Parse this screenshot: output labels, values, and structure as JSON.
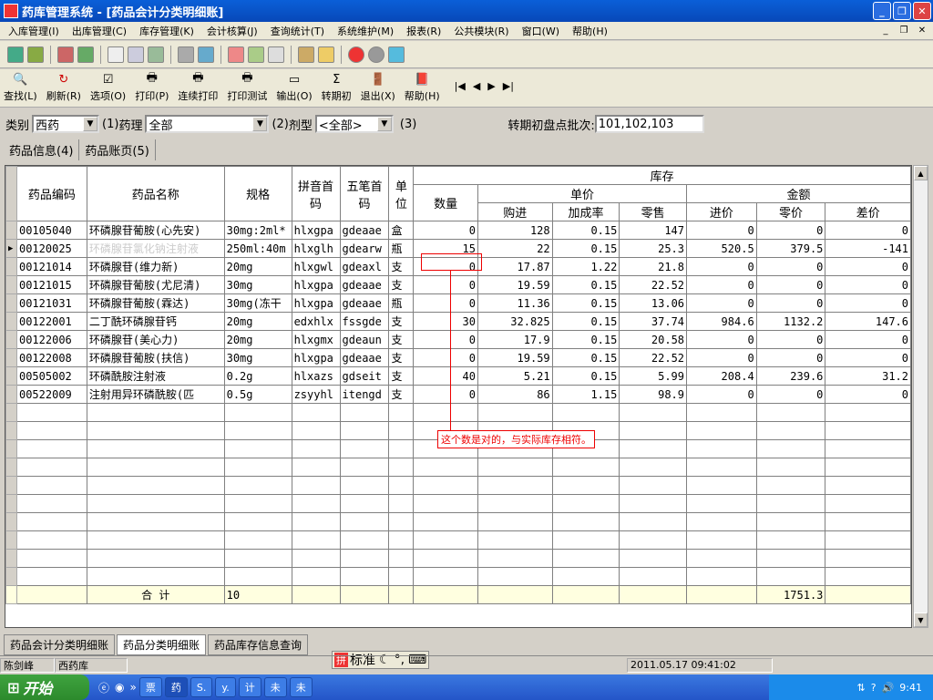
{
  "window": {
    "title": "药库管理系统 - [药品会计分类明细账]"
  },
  "menu": [
    "入库管理(I)",
    "出库管理(C)",
    "库存管理(K)",
    "会计核算(J)",
    "查询统计(T)",
    "系统维护(M)",
    "报表(R)",
    "公共模块(R)",
    "窗口(W)",
    "帮助(H)"
  ],
  "toolbar": {
    "items": [
      "查找(L)",
      "刷新(R)",
      "选项(O)",
      "打印(P)",
      "连续打印",
      "打印测试",
      "输出(O)",
      "转期初",
      "退出(X)",
      "帮助(H)"
    ]
  },
  "filter": {
    "category_label": "类别",
    "category_value": "西药",
    "pharm_prefix": "(1)",
    "pharm_label": "药理",
    "pharm_value": "全部",
    "form_prefix": "(2)",
    "form_label": "剂型",
    "form_value": "<全部>",
    "form_suffix": "(3)",
    "batch_label": "转期初盘点批次:",
    "batch_value": "101,102,103"
  },
  "tabs": [
    "药品信息(4)",
    "药品账页(5)"
  ],
  "table": {
    "headers": {
      "code": "药品编码",
      "name": "药品名称",
      "spec": "规格",
      "pinyin": "拼音首码",
      "wubi": "五笔首码",
      "unit": "单位",
      "stock": "库存",
      "qty": "数量",
      "price": "单价",
      "amount": "金额",
      "buy": "购进",
      "markup": "加成率",
      "retail": "零售",
      "cost": "进价",
      "retail_val": "零价",
      "diff": "差价"
    },
    "rows": [
      {
        "code": "00105040",
        "name": "环磷腺苷葡胺(心先安)",
        "spec": "30mg:2ml*",
        "pinyin": "hlxgpa",
        "wubi": "gdeaae",
        "unit": "盒",
        "qty": "0",
        "buy": "128",
        "markup": "0.15",
        "retail": "147",
        "cost": "0",
        "rv": "0",
        "diff": "0"
      },
      {
        "code": "00120025",
        "name": "环磷腺苷氯化钠注射液",
        "spec": "250ml:40m",
        "pinyin": "hlxglh",
        "wubi": "gdearw",
        "unit": "瓶",
        "qty": "15",
        "buy": "22",
        "markup": "0.15",
        "retail": "25.3",
        "cost": "520.5",
        "rv": "379.5",
        "diff": "-141"
      },
      {
        "code": "00121014",
        "name": "环磷腺苷(维力新)",
        "spec": "20mg",
        "pinyin": "hlxgwl",
        "wubi": "gdeaxl",
        "unit": "支",
        "qty": "0",
        "buy": "17.87",
        "markup": "1.22",
        "retail": "21.8",
        "cost": "0",
        "rv": "0",
        "diff": "0"
      },
      {
        "code": "00121015",
        "name": "环磷腺苷葡胺(尤尼清)",
        "spec": "30mg",
        "pinyin": "hlxgpa",
        "wubi": "gdeaae",
        "unit": "支",
        "qty": "0",
        "buy": "19.59",
        "markup": "0.15",
        "retail": "22.52",
        "cost": "0",
        "rv": "0",
        "diff": "0"
      },
      {
        "code": "00121031",
        "name": "环磷腺苷葡胺(霖达)",
        "spec": "30mg(冻干",
        "pinyin": "hlxgpa",
        "wubi": "gdeaae",
        "unit": "瓶",
        "qty": "0",
        "buy": "11.36",
        "markup": "0.15",
        "retail": "13.06",
        "cost": "0",
        "rv": "0",
        "diff": "0"
      },
      {
        "code": "00122001",
        "name": "二丁酰环磷腺苷钙",
        "spec": "20mg",
        "pinyin": "edxhlx",
        "wubi": "fssgde",
        "unit": "支",
        "qty": "30",
        "buy": "32.825",
        "markup": "0.15",
        "retail": "37.74",
        "cost": "984.6",
        "rv": "1132.2",
        "diff": "147.6"
      },
      {
        "code": "00122006",
        "name": "环磷腺苷(美心力)",
        "spec": "20mg",
        "pinyin": "hlxgmx",
        "wubi": "gdeaun",
        "unit": "支",
        "qty": "0",
        "buy": "17.9",
        "markup": "0.15",
        "retail": "20.58",
        "cost": "0",
        "rv": "0",
        "diff": "0"
      },
      {
        "code": "00122008",
        "name": "环磷腺苷葡胺(扶信)",
        "spec": "30mg",
        "pinyin": "hlxgpa",
        "wubi": "gdeaae",
        "unit": "支",
        "qty": "0",
        "buy": "19.59",
        "markup": "0.15",
        "retail": "22.52",
        "cost": "0",
        "rv": "0",
        "diff": "0"
      },
      {
        "code": "00505002",
        "name": "环磷酰胺注射液",
        "spec": "0.2g",
        "pinyin": "hlxazs",
        "wubi": "gdseit",
        "unit": "支",
        "qty": "40",
        "buy": "5.21",
        "markup": "0.15",
        "retail": "5.99",
        "cost": "208.4",
        "rv": "239.6",
        "diff": "31.2"
      },
      {
        "code": "00522009",
        "name": "注射用异环磷酰胺(匹",
        "spec": "0.5g",
        "pinyin": "zsyyhl",
        "wubi": "itengd",
        "unit": "支",
        "qty": "0",
        "buy": "86",
        "markup": "1.15",
        "retail": "98.9",
        "cost": "0",
        "rv": "0",
        "diff": "0"
      }
    ],
    "summary": {
      "label": "合  计",
      "count": "10",
      "retail_total": "1751.3"
    }
  },
  "annotation": "这个数是对的，与实际库存相符。",
  "bottom_tabs": [
    "药品会计分类明细账",
    "药品分类明细账",
    "药品库存信息查询"
  ],
  "status": {
    "user": "陈剑峰",
    "dept": "西药库",
    "datetime": "2011.05.17 09:41:02"
  },
  "ime": {
    "mode": "标准"
  },
  "taskbar": {
    "start": "开始",
    "tasks": [
      "票",
      "药",
      "S.",
      "y.",
      "计",
      "未",
      "未"
    ],
    "clock": "9:41"
  }
}
